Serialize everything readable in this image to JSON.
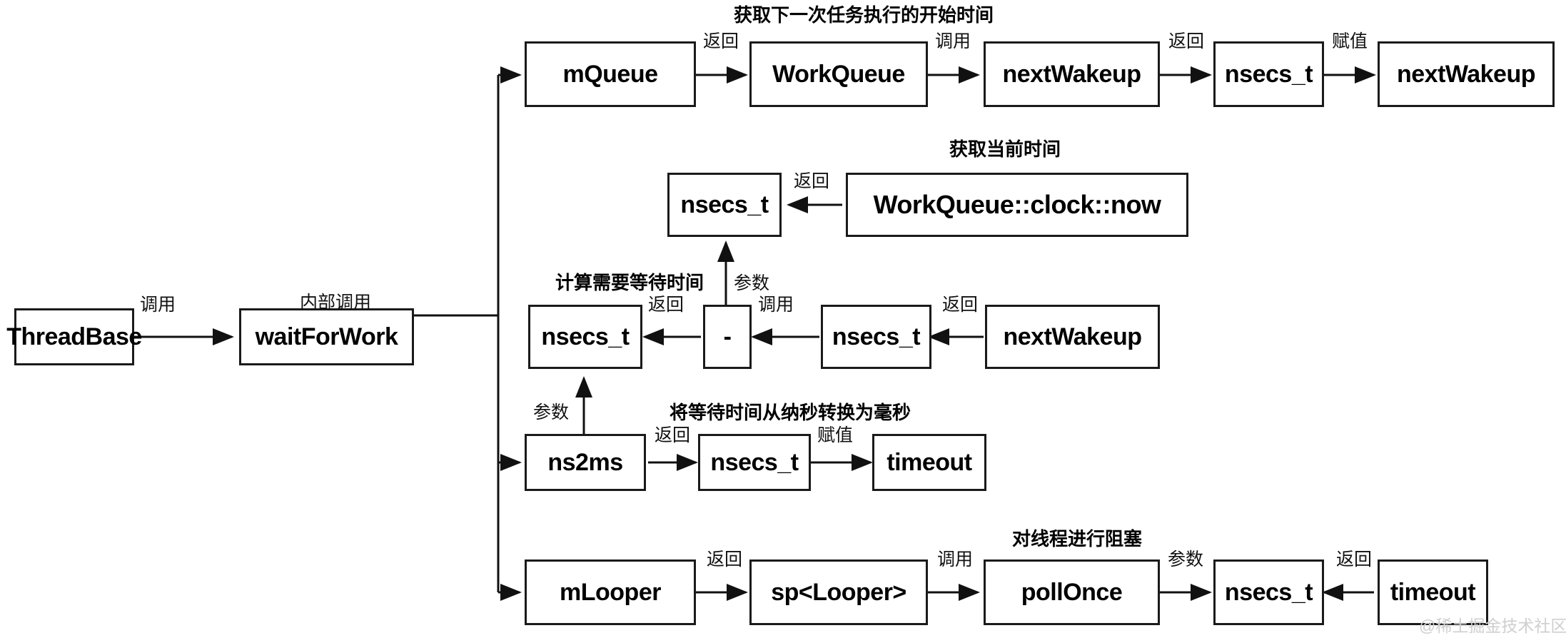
{
  "diagram": {
    "title": "ThreadBase waitForWork call flow",
    "watermark": "@稀土掘金技术社区",
    "colors": {
      "stroke": "#1a1a1a",
      "background": "#ffffff",
      "text": "#000000",
      "watermark": "#cfcfcf"
    },
    "nodes": {
      "thread_base": "ThreadBase",
      "wait_for_work": "waitForWork",
      "m_queue": "mQueue",
      "work_queue": "WorkQueue",
      "next_wakeup_call": "nextWakeup",
      "nsecs_t_top": "nsecs_t",
      "next_wakeup_assign": "nextWakeup",
      "nsecs_t_now": "nsecs_t",
      "work_queue_clock_now": "WorkQueue::clock::now",
      "nsecs_t_wait": "nsecs_t",
      "minus_op": "-",
      "nsecs_t_param": "nsecs_t",
      "next_wakeup_src": "nextWakeup",
      "ns2ms": "ns2ms",
      "nsecs_t_ms": "nsecs_t",
      "timeout_assign": "timeout",
      "m_looper": "mLooper",
      "sp_looper": "sp<Looper>",
      "poll_once": "pollOnce",
      "nsecs_t_poll": "nsecs_t",
      "timeout_src": "timeout"
    },
    "edge_labels": {
      "threadbase_to_waitforwork": "调用",
      "waitforwork_internal": "内部调用",
      "mqueue_to_workqueue": "返回",
      "workqueue_to_nextwakeup": "调用",
      "nextwakeup_to_nsecst": "返回",
      "nsecst_to_nextwakeup": "赋值",
      "clocknow_to_nsecst": "返回",
      "minus_to_nsecst_param": "参数",
      "minus_to_nsecst_wait": "返回",
      "nsecst_to_minus": "调用",
      "nextwakeup_to_nsecst_param": "返回",
      "ns2ms_param": "参数",
      "ns2ms_to_nsecst": "返回",
      "nsecst_to_timeout": "赋值",
      "mlooper_to_splooper": "返回",
      "splooper_to_pollonce": "调用",
      "pollonce_to_nsecst": "参数",
      "timeout_to_nsecst": "返回"
    },
    "notes": {
      "next_task_start_time": "获取下一次任务执行的开始时间",
      "current_time": "获取当前时间",
      "calc_wait_time": "计算需要等待时间",
      "ns_to_ms": "将等待时间从纳秒转换为毫秒",
      "block_thread": "对线程进行阻塞"
    }
  }
}
